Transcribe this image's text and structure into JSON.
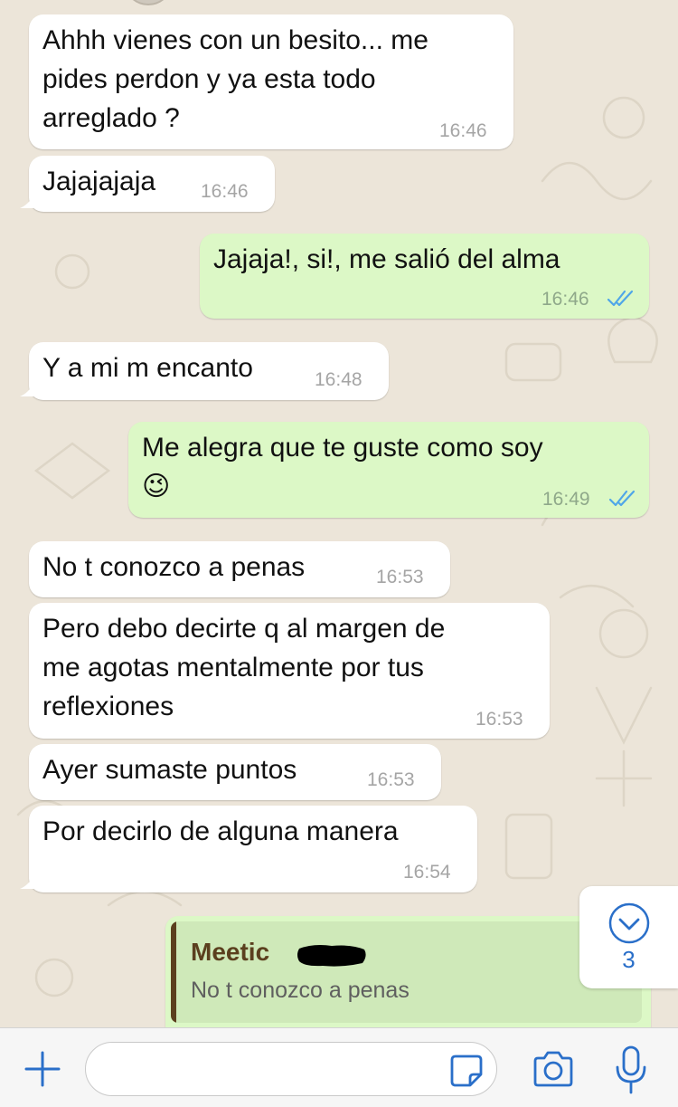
{
  "colors": {
    "incoming_bubble": "#ffffff",
    "outgoing_bubble": "#dcf8c6",
    "timestamp": "#a5a5a5",
    "read_ticks": "#4fa6e8",
    "quote_accent": "#5b3f1e",
    "scroll_count": "#2a6fc9"
  },
  "messages": [
    {
      "direction": "in",
      "text": "Ahhh vienes con un besito... me\npides perdon y ya esta todo\narreglado ?",
      "time": "16:46"
    },
    {
      "direction": "in",
      "text": "Jajajajaja",
      "time": "16:46"
    },
    {
      "direction": "out",
      "text": "Jajaja!, si!, me salió del alma",
      "time": "16:46",
      "status": "read"
    },
    {
      "direction": "in",
      "text": "Y a mi m encanto",
      "time": "16:48"
    },
    {
      "direction": "out",
      "text": "Me alegra que te guste como soy\n😉",
      "time": "16:49",
      "status": "read"
    },
    {
      "direction": "in",
      "text": "No t conozco a penas",
      "time": "16:53"
    },
    {
      "direction": "in",
      "text": "Pero debo decirte q al margen de\nme agotas mentalmente por tus\nreflexiones",
      "time": "16:53"
    },
    {
      "direction": "in",
      "text": "Ayer sumaste puntos",
      "time": "16:53"
    },
    {
      "direction": "in",
      "text": "Por decirlo de alguna manera",
      "time": "16:54"
    }
  ],
  "reply_preview": {
    "sender": "Meetic",
    "quoted_text": "No t conozco a penas"
  },
  "scroll_to_bottom": {
    "icon": "chevron-down-circle-icon",
    "unread_count": "3"
  },
  "composer": {
    "value": "",
    "placeholder": "",
    "icons": [
      "plus-icon",
      "sticker-icon",
      "camera-icon",
      "microphone-icon"
    ]
  }
}
